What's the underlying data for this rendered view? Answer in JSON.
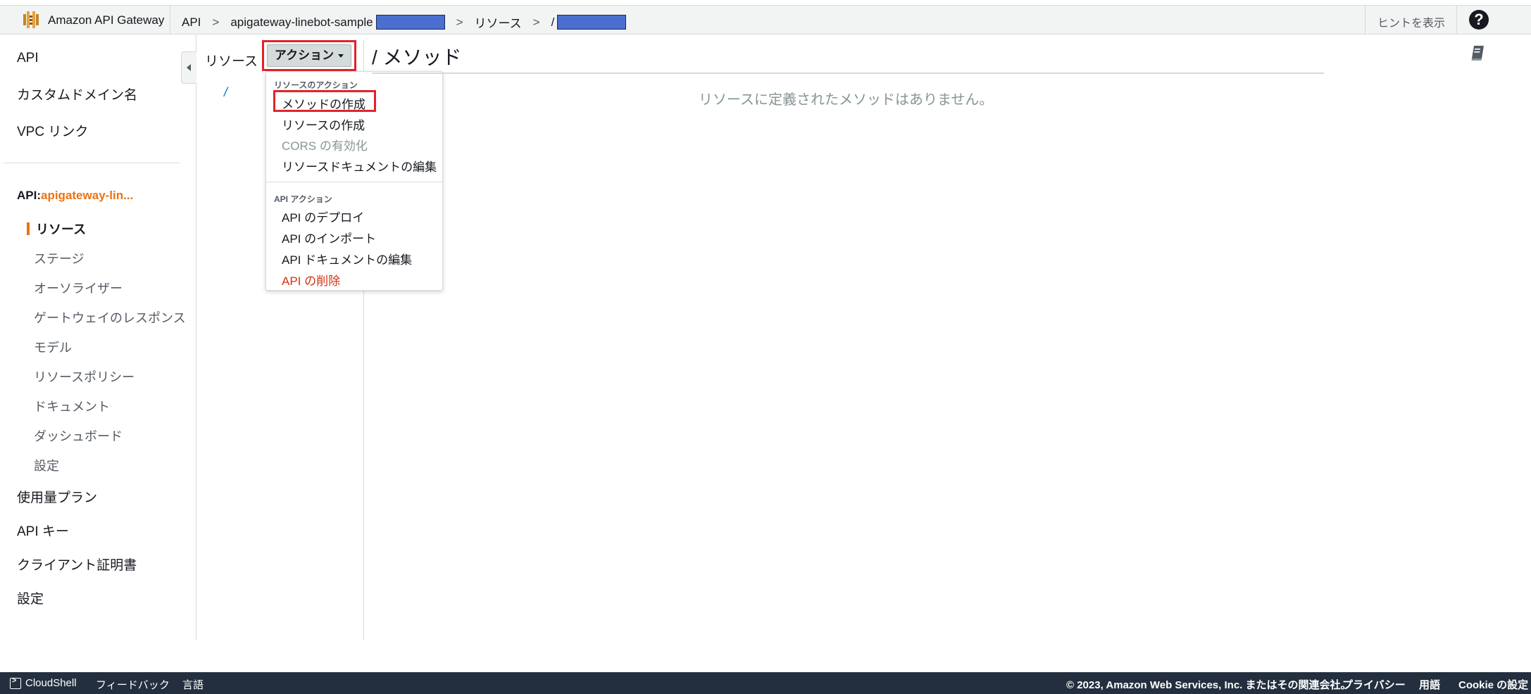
{
  "topbar": {
    "service_name": "Amazon API Gateway",
    "breadcrumbs": [
      "API",
      "apigateway-linebot-sample",
      "リソース",
      "/"
    ],
    "separator": ">",
    "hint_label": "ヒントを表示",
    "help_label": "?"
  },
  "nav": {
    "top_items": [
      "API",
      "カスタムドメイン名",
      "VPC リンク"
    ],
    "api_prefix": "API:",
    "api_name": "apigateway-lin...",
    "active_item": "リソース",
    "sub_items": [
      "ステージ",
      "オーソライザー",
      "ゲートウェイのレスポンス",
      "モデル",
      "リソースポリシー",
      "ドキュメント",
      "ダッシュボード",
      "設定"
    ],
    "bottom_items": [
      "使用量プラン",
      "API キー",
      "クライアント証明書",
      "設定"
    ]
  },
  "resources": {
    "title": "リソース",
    "root": "/",
    "actions_label": "アクション"
  },
  "dropdown": {
    "resource_group": "リソースのアクション",
    "resource_items": [
      "メソッドの作成",
      "リソースの作成",
      "CORS の有効化",
      "リソースドキュメントの編集"
    ],
    "api_group": "API アクション",
    "api_items": [
      "API のデプロイ",
      "API のインポート",
      "API ドキュメントの編集",
      "API の削除"
    ]
  },
  "method": {
    "title": "/ メソッド",
    "empty_message": "リソースに定義されたメソッドはありません。"
  },
  "footer": {
    "cloudshell": "CloudShell",
    "feedback": "フィードバック",
    "language": "言語",
    "copyright": "© 2023, Amazon Web Services, Inc. またはその関連会社。",
    "privacy": "プライバシー",
    "terms": "用語",
    "cookie": "Cookie の設定"
  },
  "colors": {
    "accent": "#ec7211",
    "highlight": "#e0242a",
    "redaction": "#4a6fd0",
    "footer_bg": "#232f3e",
    "link": "#0073bb"
  }
}
